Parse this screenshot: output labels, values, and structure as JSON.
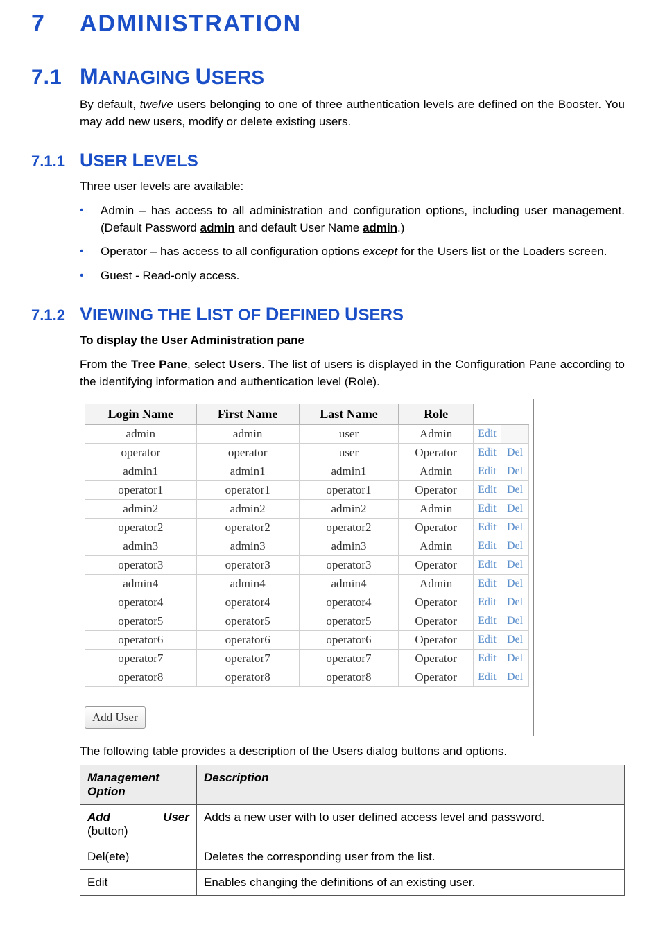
{
  "h1": {
    "num": "7",
    "title": "ADMINISTRATION"
  },
  "h2": {
    "num": "7.1",
    "title_pre": "M",
    "title_rest": "ANAGING ",
    "title_pre2": "U",
    "title_rest2": "SERS"
  },
  "intro": {
    "p1a": "By default, ",
    "p1b": "twelve",
    "p1c": " users belonging to one of three authentication levels are defined on the Booster. You may add new users, modify or delete existing users."
  },
  "h3a": {
    "num": "7.1.1",
    "title": "USER LEVELS"
  },
  "levels_intro": "Three user levels are available:",
  "levels": {
    "admin_a": "Admin – has access to all administration and configuration options, including user management. (Default Password ",
    "admin_b": "admin",
    "admin_c": " and default User Name ",
    "admin_d": "admin",
    "admin_e": ".)",
    "operator_a": "Operator – has access to all configuration options ",
    "operator_b": "except",
    "operator_c": " for the Users list or the Loaders screen.",
    "guest": "Guest - Read-only access."
  },
  "h3b": {
    "num": "7.1.2",
    "title": "VIEWING THE LIST OF DEFINED USERS"
  },
  "subhead": "To display the User Administration pane",
  "viewing_para": {
    "a": "From the ",
    "b": "Tree Pane",
    "c": ", select ",
    "d": "Users",
    "e": ". The list of users is displayed in the Configuration Pane according to the identifying information and authentication level (Role)."
  },
  "users_table": {
    "headers": [
      "Login Name",
      "First Name",
      "Last Name",
      "Role"
    ],
    "edit": "Edit",
    "del": "Del",
    "rows": [
      {
        "login": "admin",
        "first": "admin",
        "last": "user",
        "role": "Admin",
        "del": false
      },
      {
        "login": "operator",
        "first": "operator",
        "last": "user",
        "role": "Operator",
        "del": true
      },
      {
        "login": "admin1",
        "first": "admin1",
        "last": "admin1",
        "role": "Admin",
        "del": true
      },
      {
        "login": "operator1",
        "first": "operator1",
        "last": "operator1",
        "role": "Operator",
        "del": true
      },
      {
        "login": "admin2",
        "first": "admin2",
        "last": "admin2",
        "role": "Admin",
        "del": true
      },
      {
        "login": "operator2",
        "first": "operator2",
        "last": "operator2",
        "role": "Operator",
        "del": true
      },
      {
        "login": "admin3",
        "first": "admin3",
        "last": "admin3",
        "role": "Admin",
        "del": true
      },
      {
        "login": "operator3",
        "first": "operator3",
        "last": "operator3",
        "role": "Operator",
        "del": true
      },
      {
        "login": "admin4",
        "first": "admin4",
        "last": "admin4",
        "role": "Admin",
        "del": true
      },
      {
        "login": "operator4",
        "first": "operator4",
        "last": "operator4",
        "role": "Operator",
        "del": true
      },
      {
        "login": "operator5",
        "first": "operator5",
        "last": "operator5",
        "role": "Operator",
        "del": true
      },
      {
        "login": "operator6",
        "first": "operator6",
        "last": "operator6",
        "role": "Operator",
        "del": true
      },
      {
        "login": "operator7",
        "first": "operator7",
        "last": "operator7",
        "role": "Operator",
        "del": true
      },
      {
        "login": "operator8",
        "first": "operator8",
        "last": "operator8",
        "role": "Operator",
        "del": true
      }
    ],
    "add_user": "Add User"
  },
  "after_table": "The following table provides a description of the Users dialog buttons and options.",
  "mgmt": {
    "h1": "Management Option",
    "h2": "Description",
    "rows": [
      {
        "opt_a": "Add",
        "opt_b": "User",
        "opt_c": "(button)",
        "desc": "Adds a new user with to user defined access level and password."
      },
      {
        "opt": "Del(ete)",
        "desc": "Deletes the corresponding user from the list."
      },
      {
        "opt": "Edit",
        "desc": "Enables changing the definitions of an existing user."
      }
    ]
  }
}
